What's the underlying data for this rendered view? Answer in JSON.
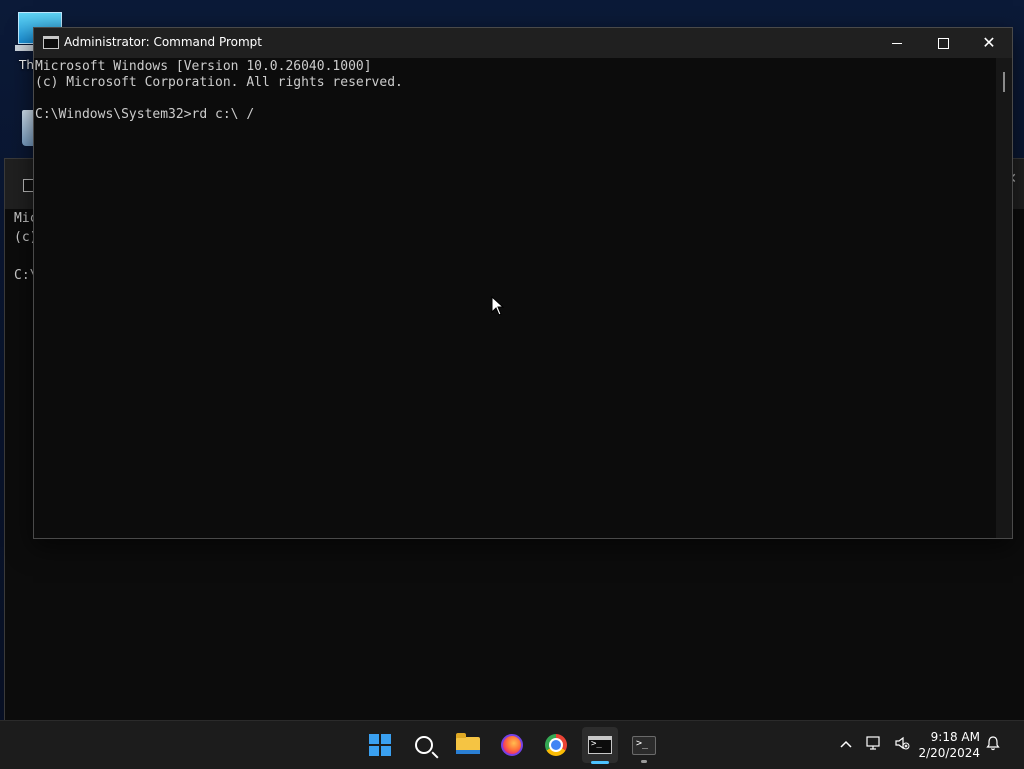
{
  "desktop": {
    "this_pc_label": "Th"
  },
  "bg_window": {
    "lines": [
      "Mic",
      "(c)",
      "",
      "C:\\"
    ]
  },
  "window": {
    "title": "Administrator: Command Prompt",
    "minimize_glyph": "",
    "close_glyph": "✕"
  },
  "console": {
    "text": "Microsoft Windows [Version 10.0.26040.1000]\n(c) Microsoft Corporation. All rights reserved.\n\nC:\\Windows\\System32>rd c:\\ /"
  },
  "taskbar": {
    "apps": [
      {
        "name": "Start",
        "icon": "windows-start-icon"
      },
      {
        "name": "Search",
        "icon": "search-icon"
      },
      {
        "name": "File Explorer",
        "icon": "folder-icon"
      },
      {
        "name": "Firefox",
        "icon": "firefox-icon"
      },
      {
        "name": "Google Chrome",
        "icon": "chrome-icon"
      },
      {
        "name": "Command Prompt",
        "icon": "cmd-icon",
        "active": true
      },
      {
        "name": "Terminal",
        "icon": "terminal-icon"
      }
    ],
    "tray": {
      "chevron": "^",
      "time": "9:18 AM",
      "date": "2/20/2024"
    }
  },
  "colors": {
    "accent": "#4cc2ff",
    "console_bg": "#0c0c0c",
    "console_fg": "#cccccc",
    "titlebar": "#202020",
    "taskbar": "#1c1c1c"
  }
}
